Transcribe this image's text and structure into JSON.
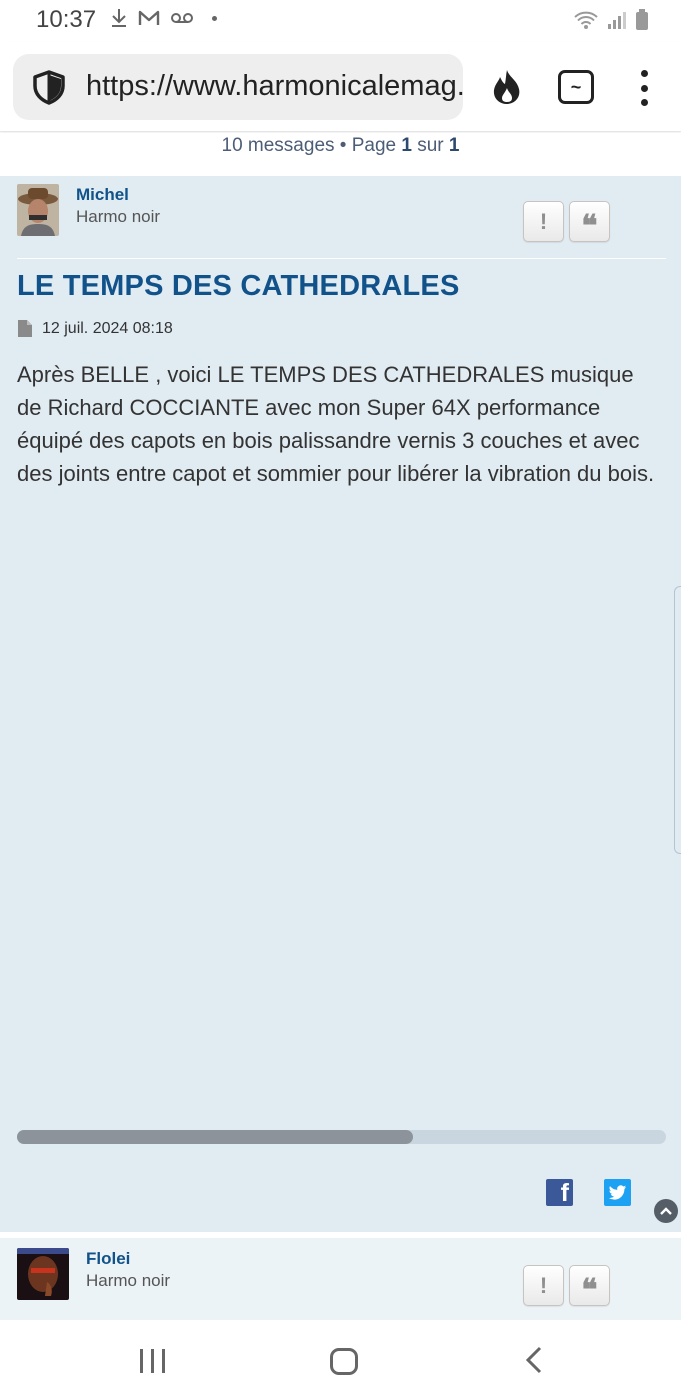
{
  "status_bar": {
    "time": "10:37"
  },
  "browser": {
    "url": "https://www.harmonicalemag.com",
    "tab_label": "~"
  },
  "pagination": {
    "prefix": "10 messages • Page ",
    "current": "1",
    "middle": " sur ",
    "total": "1"
  },
  "posts": [
    {
      "author": "Michel",
      "rank": "Harmo noir",
      "title": "LE TEMPS DES CATHEDRALES",
      "date": "12 juil. 2024 08:18",
      "body": "Après BELLE , voici LE TEMPS DES CATHEDRALES musique de Richard COCCIANTE avec mon Super 64X performance équipé des capots en bois palissandre vernis 3 couches et avec des joints entre capot et sommier pour libérer la vibration du bois.",
      "report_label": "!",
      "quote_label": "❝",
      "embed_scroll_fraction": 0.61
    },
    {
      "author": "Flolei",
      "rank": "Harmo noir",
      "report_label": "!",
      "quote_label": "❝"
    }
  ],
  "share": {
    "facebook_label": "f"
  },
  "colors": {
    "post_bg": "#e1ebf2",
    "link": "#105289",
    "facebook": "#3b5998",
    "twitter": "#1da1f2"
  }
}
